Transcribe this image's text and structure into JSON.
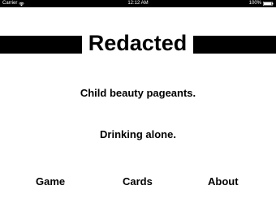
{
  "status_bar": {
    "carrier": "Carrier",
    "time": "12:12 AM",
    "battery_percent": "100%",
    "icons": [
      "wifi-icon",
      "battery-icon"
    ]
  },
  "app": {
    "title": "Redacted"
  },
  "cards": [
    {
      "text": "Child beauty pageants."
    },
    {
      "text": "Drinking alone."
    }
  ],
  "nav": {
    "items": [
      {
        "label": "Game"
      },
      {
        "label": "Cards"
      },
      {
        "label": "About"
      }
    ]
  },
  "colors": {
    "background": "#ffffff",
    "text": "#000000",
    "status_bar": "#000000"
  }
}
